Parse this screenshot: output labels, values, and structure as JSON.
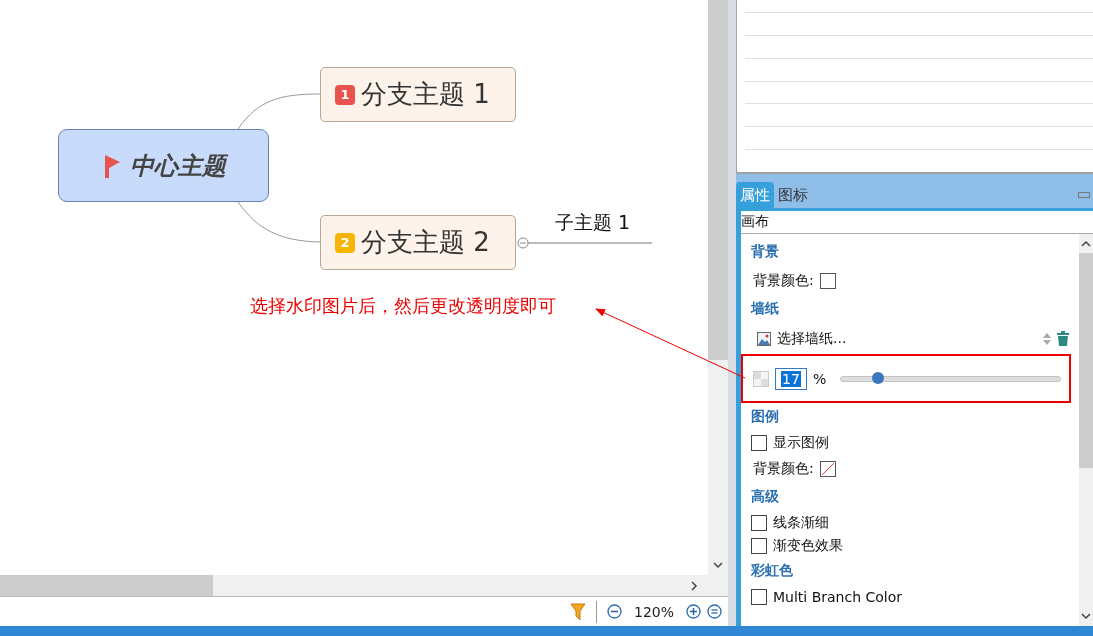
{
  "mindmap": {
    "central_topic": {
      "label": "中心主题"
    },
    "branches": [
      {
        "number": "1",
        "label": "分支主题 1",
        "color": "#e8524f"
      },
      {
        "number": "2",
        "label": "分支主题 2",
        "color": "#f7b500",
        "children": [
          {
            "label": "子主题 1"
          }
        ]
      }
    ],
    "annotation": "选择水印图片后，然后更改透明度即可"
  },
  "status_bar": {
    "zoom": "120%"
  },
  "panel": {
    "tabs": [
      {
        "label": "属性",
        "selected": true
      },
      {
        "label": "图标",
        "selected": false
      }
    ],
    "heading": "画布",
    "sections": [
      {
        "title": "背景",
        "rows": [
          {
            "kind": "color",
            "label": "背景颜色:",
            "transparent": false
          }
        ]
      },
      {
        "title": "墙纸",
        "rows": [
          {
            "kind": "wallpaper",
            "label": "选择墙纸..."
          },
          {
            "kind": "opacity",
            "value": "17",
            "unit": "%",
            "level": 0.17,
            "highlighted": true
          }
        ]
      },
      {
        "title": "图例",
        "rows": [
          {
            "kind": "checkbox",
            "label": "显示图例",
            "checked": false
          },
          {
            "kind": "color",
            "label": "背景颜色:",
            "transparent": true
          }
        ]
      },
      {
        "title": "高级",
        "rows": [
          {
            "kind": "checkbox",
            "label": "线条渐细",
            "checked": false
          },
          {
            "kind": "checkbox",
            "label": "渐变色效果",
            "checked": false
          }
        ]
      },
      {
        "title": "彩虹色",
        "rows": [
          {
            "kind": "checkbox",
            "label": "Multi Branch Color",
            "checked": false
          }
        ]
      }
    ]
  }
}
